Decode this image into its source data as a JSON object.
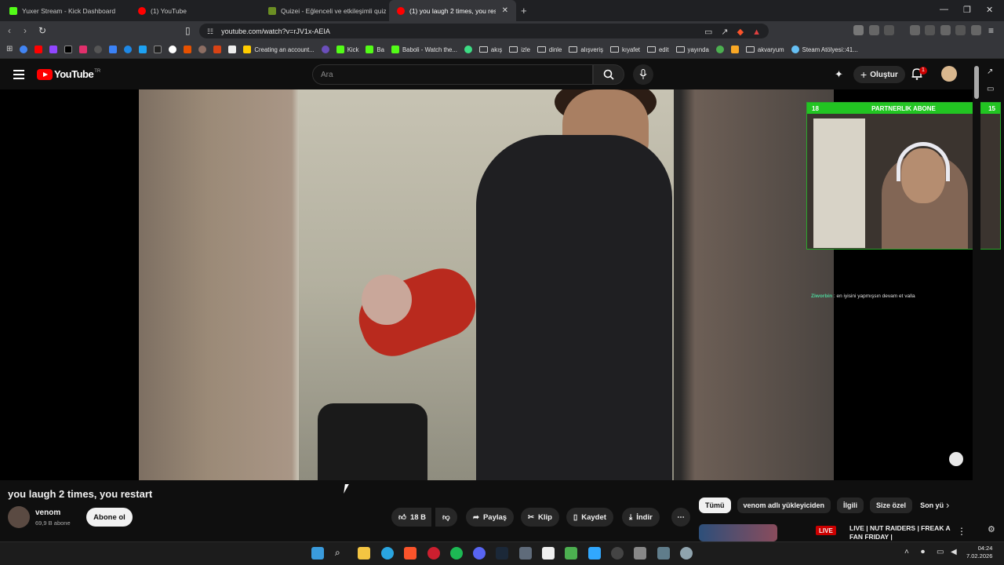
{
  "browser": {
    "tabs": [
      {
        "label": "Yuxer Stream - Kick Dashboard",
        "color": "#53fc18"
      },
      {
        "label": "(1) YouTube",
        "color": "#ff0000"
      },
      {
        "label": "Quizei - Eğlenceli ve etkileşimli quiz",
        "color": "#6b8e23"
      },
      {
        "label": "(1) you laugh 2 times, you restart",
        "color": "#ff0000"
      }
    ],
    "url": "youtube.com/watch?v=rJV1x-AEIA",
    "bookmarks": [
      {
        "label": "Creating an account...",
        "type": "site",
        "color": "#ffcc00"
      },
      {
        "label": "Kick",
        "type": "site",
        "color": "#53fc18"
      },
      {
        "label": "Ba",
        "type": "site",
        "color": "#53fc18"
      },
      {
        "label": "Baboli - Watch the...",
        "type": "site",
        "color": "#53fc18"
      },
      {
        "label": "akış",
        "type": "folder"
      },
      {
        "label": "izle",
        "type": "folder"
      },
      {
        "label": "dinle",
        "type": "folder"
      },
      {
        "label": "alışveriş",
        "type": "folder"
      },
      {
        "label": "kıyafet",
        "type": "folder"
      },
      {
        "label": "edit",
        "type": "folder"
      },
      {
        "label": "yayında",
        "type": "folder"
      },
      {
        "label": "akvaryum",
        "type": "folder"
      },
      {
        "label": "Steam Atölyesi::41...",
        "type": "site",
        "color": "#1b2838"
      }
    ]
  },
  "youtube": {
    "logo_text": "YouTube",
    "country_code": "TR",
    "search_placeholder": "Ara",
    "create_label": "Oluştur",
    "notification_count": "1"
  },
  "overlay": {
    "webcam_banner": "PARTNERLIK ABONE",
    "banner_left": "18",
    "banner_right": "15",
    "chat_user": "Ziworbin",
    "chat_message": "en iyisini yapmışsın devam et valla"
  },
  "video": {
    "title": "you laugh 2 times, you restart",
    "channel": "venom",
    "subscribers": "69,9 B abone",
    "subscribe_label": "Abone ol",
    "likes": "18 B",
    "share_label": "Paylaş",
    "clip_label": "Klip",
    "save_label": "Kaydet",
    "download_label": "İndir"
  },
  "sidebar": {
    "chips": [
      "Tümü",
      "venom adlı yükleyiciden",
      "İlgili",
      "Size özel",
      "Son yü"
    ],
    "selected_chip": "Tümü",
    "recommendation": {
      "live_label": "LIVE",
      "title": "LIVE | NUT RAIDERS | FREAK A FAN FRIDAY |"
    }
  },
  "taskbar": {
    "time": "04:24",
    "date": "7.02.2026"
  }
}
